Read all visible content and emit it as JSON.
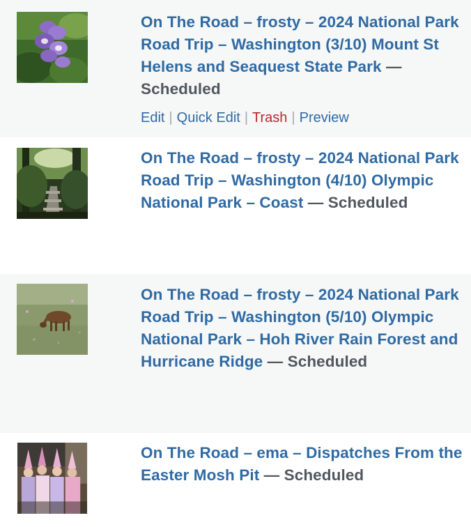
{
  "rows": [
    {
      "title": "On The Road – frosty – 2024 National Park Road Trip – Washington (3/10) Mount St Helens and Seaquest State Park",
      "status": " — Scheduled",
      "thumbnail": "foxglove flowers",
      "actions": {
        "edit": "Edit",
        "quick_edit": "Quick Edit",
        "trash": "Trash",
        "preview": "Preview",
        "separator": "|"
      }
    },
    {
      "title": "On The Road – frosty – 2024 National Park Road Trip – Washington (4/10) Olympic National Park – Coast",
      "status": " — Scheduled",
      "thumbnail": "forest trail"
    },
    {
      "title": "On The Road – frosty – 2024 National Park Road Trip – Washington (5/10) Olympic National Park – Hoh River Rain Forest and Hurricane Ridge",
      "status": " — Scheduled",
      "thumbnail": "deer in meadow"
    },
    {
      "title": "On The Road – ema – Dispatches From the Easter Mosh Pit",
      "status": " — Scheduled",
      "thumbnail": "costumed crowd"
    }
  ],
  "colors": {
    "link": "#2f6aa3",
    "status": "#50575e",
    "trash": "#b32d2e",
    "alt_row": "#f6f7f7"
  }
}
